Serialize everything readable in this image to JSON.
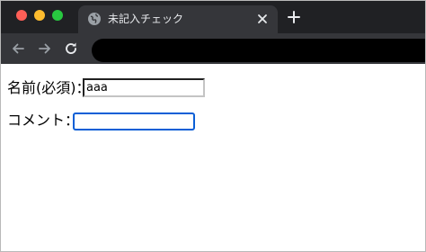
{
  "window": {
    "traffic_lights": {
      "close": "#ff5f57",
      "minimize": "#febc2e",
      "maximize": "#28c840"
    }
  },
  "tab": {
    "title": "未記入チェック",
    "icon": "globe-icon"
  },
  "toolbar": {
    "back_icon": "arrow-left-icon",
    "forward_icon": "arrow-right-icon",
    "reload_icon": "reload-icon"
  },
  "form": {
    "name_label": "名前(必須)：",
    "name_value": "aaa",
    "comment_label": "コメント：",
    "comment_value": ""
  }
}
